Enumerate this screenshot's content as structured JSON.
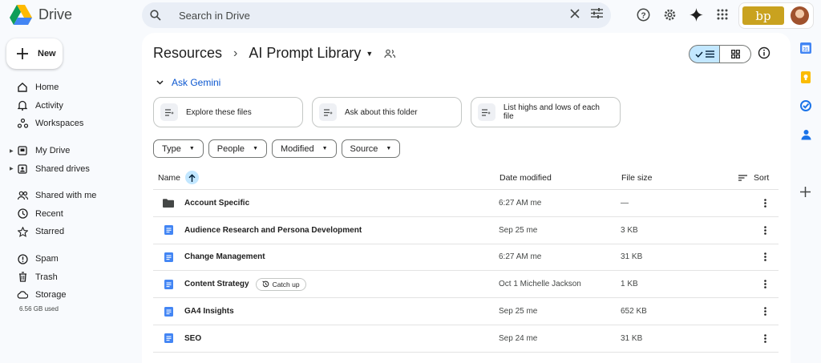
{
  "app": {
    "name": "Drive"
  },
  "search": {
    "placeholder": "Search in Drive"
  },
  "org_badge": "bp",
  "new_button": {
    "label": "New"
  },
  "nav": {
    "group1": [
      {
        "label": "Home",
        "icon": "home-icon"
      },
      {
        "label": "Activity",
        "icon": "bell-icon"
      },
      {
        "label": "Workspaces",
        "icon": "workspaces-icon"
      }
    ],
    "group2": [
      {
        "label": "My Drive",
        "icon": "my-drive-icon"
      },
      {
        "label": "Shared drives",
        "icon": "shared-drives-icon"
      }
    ],
    "group3": [
      {
        "label": "Shared with me",
        "icon": "people-icon"
      },
      {
        "label": "Recent",
        "icon": "clock-icon"
      },
      {
        "label": "Starred",
        "icon": "star-icon"
      }
    ],
    "group4": [
      {
        "label": "Spam",
        "icon": "spam-icon"
      },
      {
        "label": "Trash",
        "icon": "trash-icon"
      },
      {
        "label": "Storage",
        "icon": "cloud-icon"
      }
    ],
    "storage_used": "6.56 GB used"
  },
  "breadcrumb": {
    "parent": "Resources",
    "current": "AI Prompt Library"
  },
  "gemini": {
    "header": "Ask Gemini",
    "chips": [
      "Explore these files",
      "Ask about this folder",
      "List highs and lows of each file"
    ]
  },
  "filters": [
    "Type",
    "People",
    "Modified",
    "Source"
  ],
  "table": {
    "columns": {
      "name": "Name",
      "date": "Date modified",
      "size": "File size",
      "sort": "Sort"
    },
    "rows": [
      {
        "type": "folder",
        "name": "Account Specific",
        "date": "6:27 AM me",
        "size": "—"
      },
      {
        "type": "doc",
        "name": "Audience Research and Persona Development",
        "date": "Sep 25 me",
        "size": "3 KB"
      },
      {
        "type": "doc",
        "name": "Change Management",
        "date": "6:27 AM me",
        "size": "31 KB"
      },
      {
        "type": "doc",
        "name": "Content Strategy",
        "badge": "Catch up",
        "date": "Oct 1 Michelle Jackson",
        "size": "1 KB"
      },
      {
        "type": "doc",
        "name": "GA4 Insights",
        "date": "Sep 25 me",
        "size": "652 KB"
      },
      {
        "type": "doc",
        "name": "SEO",
        "date": "Sep 24 me",
        "size": "31 KB"
      }
    ]
  },
  "colors": {
    "accent": "#0b57d0",
    "selected": "#c2e7ff",
    "doc_blue": "#4285f4",
    "background": "#f8fafd"
  }
}
